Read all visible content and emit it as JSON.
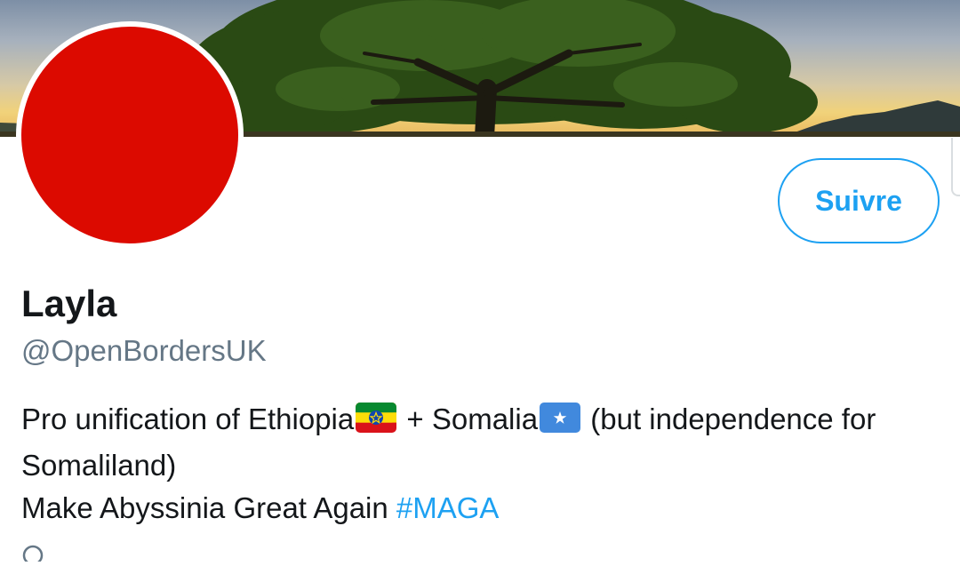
{
  "profile": {
    "name": "Layla",
    "handle": "@OpenBordersUK",
    "avatar_color": "#dc0a00",
    "follow_label": "Suivre",
    "bio": {
      "line1_prefix": "Pro unification of Ethiopia",
      "flag1": "ethiopia-flag-emoji",
      "line1_middle": " + Somalia",
      "flag2": "somalia-flag-emoji",
      "line1_suffix": " (but independence for Somaliland)",
      "line2_prefix": "Make Abyssinia Great Again ",
      "hashtag": "#MAGA"
    }
  },
  "colors": {
    "accent": "#1da1f2",
    "secondary_text": "#657786",
    "primary_text": "#14171a"
  },
  "icons": {
    "location": "location-pin-icon"
  }
}
